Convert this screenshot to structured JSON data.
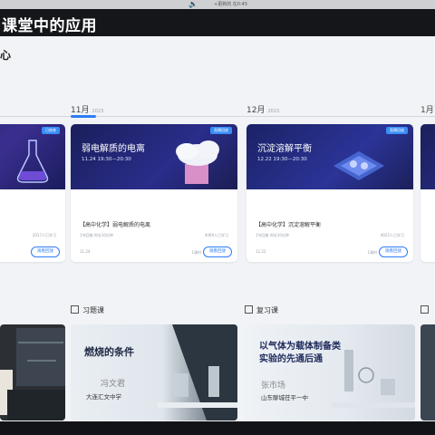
{
  "status_bar": {
    "speaker": "🔈",
    "info": "+更新的 在0:45"
  },
  "window": {
    "title": "课堂中的应用"
  },
  "page": {
    "header": "心"
  },
  "timeline": {
    "months": [
      {
        "label": "11月",
        "sub": "2023"
      },
      {
        "label": "12月",
        "sub": "2023"
      },
      {
        "label": "1月",
        "sub": ""
      }
    ]
  },
  "cards": [
    {
      "badge": "已结束",
      "title": "",
      "time": "",
      "label": "",
      "meta_left": "",
      "meta_right": "2017人已学习",
      "foot": "",
      "count": "",
      "button": "观看回放"
    },
    {
      "badge": "直播回放",
      "title": "弱电解质的电离",
      "time": "11.24  19:30—20:30",
      "label": "【高中化学】弱电解质的电离",
      "meta_left": "1节回放  时长10分钟",
      "meta_right": "4069人已学习",
      "foot": "11.24",
      "count": "1课时",
      "button": "观看回放"
    },
    {
      "badge": "直播回放",
      "title": "沉淀溶解平衡",
      "time": "12.22  19:30—20:30",
      "label": "【高中化学】沉淀溶解平衡",
      "meta_left": "1节回放  时长10分钟",
      "meta_right": "4025人已学习",
      "foot": "12.22",
      "count": "1课时",
      "button": "观看回放"
    }
  ],
  "categories": [
    {
      "label": "习题课"
    },
    {
      "label": "复习课"
    }
  ],
  "videos": [
    {
      "title": "",
      "name": "",
      "school": ""
    },
    {
      "title": "燃烧的条件",
      "name": "冯文君",
      "school": "大连汇文中学"
    },
    {
      "title": "以气体为载体制备类实验的先通后通",
      "title_line1": "以气体为载体制备类",
      "title_line2": "实验的先通后通",
      "name": "张市场",
      "school": "山东聊城茌平一中"
    }
  ]
}
